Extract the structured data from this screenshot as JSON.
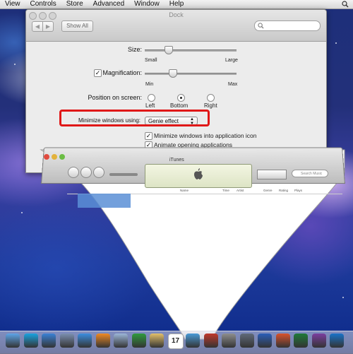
{
  "menubar": {
    "items": [
      "View",
      "Controls",
      "Store",
      "Advanced",
      "Window",
      "Help"
    ]
  },
  "dock_prefs": {
    "title": "Dock",
    "show_all": "Show All",
    "size": {
      "label": "Size:",
      "min": "Small",
      "max": "Large",
      "value_fraction": 0.25
    },
    "magnification": {
      "label": "Magnification:",
      "checked": true,
      "min": "Min",
      "max": "Max",
      "value_fraction": 0.3
    },
    "position": {
      "label": "Position on screen:",
      "options": [
        "Left",
        "Bottom",
        "Right"
      ],
      "selected": "Bottom"
    },
    "minimize": {
      "label": "Minimize windows using:",
      "value": "Genie effect"
    },
    "checkboxes": [
      {
        "label": "Minimize windows into application icon",
        "checked": true
      },
      {
        "label": "Animate opening applications",
        "checked": true
      }
    ]
  },
  "itunes": {
    "title": "iTunes",
    "search_placeholder": "Search Music",
    "columns": [
      "Name",
      "Time",
      "Artist",
      "Genre",
      "Rating",
      "Plays"
    ]
  },
  "colors": {
    "highlight": "#e01818",
    "itunes_selection": "#5b8fd6"
  },
  "dock": {
    "icons": [
      "finder-icon",
      "skype-icon",
      "app-store-icon",
      "mail-icon",
      "safari-icon",
      "vlc-icon",
      "preview-icon",
      "utorrent-icon",
      "notes-icon",
      "calendar-icon",
      "itunes-icon",
      "photo-booth-icon",
      "system-preferences-icon",
      "launchpad-icon",
      "word-icon",
      "powerpoint-icon",
      "excel-icon",
      "onenote-icon",
      "outlook-icon"
    ],
    "calendar_day": "17"
  }
}
